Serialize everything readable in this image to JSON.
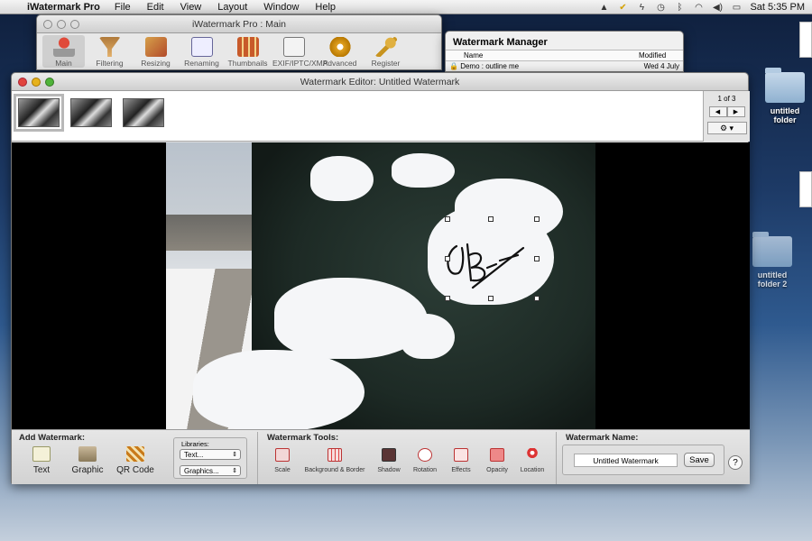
{
  "menubar": {
    "app": "iWatermark Pro",
    "items": [
      "File",
      "Edit",
      "View",
      "Layout",
      "Window",
      "Help"
    ],
    "clock": "Sat 5:35 PM"
  },
  "main_window": {
    "title": "iWatermark Pro : Main",
    "tools": [
      {
        "label": "Main",
        "icon": "stamp-icon"
      },
      {
        "label": "Filtering",
        "icon": "funnel-icon"
      },
      {
        "label": "Resizing",
        "icon": "resize-icon"
      },
      {
        "label": "Renaming",
        "icon": "rename-icon"
      },
      {
        "label": "Thumbnails",
        "icon": "thumbnails-icon"
      },
      {
        "label": "EXIF/IPTC/XMP",
        "icon": "exif-icon"
      },
      {
        "label": "Advanced",
        "icon": "gear-icon"
      },
      {
        "label": "Register",
        "icon": "key-icon"
      }
    ]
  },
  "watermark_manager": {
    "title": "Watermark Manager",
    "col_name": "Name",
    "col_modified": "Modified",
    "row_name": "Demo : outline me",
    "row_modified": "Wed 4 July"
  },
  "editor": {
    "title": "Watermark Editor: Untitled Watermark",
    "page_indicator": "1 of 3",
    "prev": "◀",
    "next": "▶",
    "gear": "⚙ ▾"
  },
  "bottom": {
    "add_title": "Add Watermark:",
    "add_text": "Text",
    "add_graphic": "Graphic",
    "add_qr": "QR Code",
    "libraries_label": "Libraries:",
    "lib_text": "Text...",
    "lib_graphics": "Graphics...",
    "tools_title": "Watermark Tools:",
    "tools": [
      "Scale",
      "Background & Border",
      "Shadow",
      "Rotation",
      "Effects",
      "Opacity",
      "Location"
    ],
    "name_title": "Watermark Name:",
    "name_value": "Untitled Watermark",
    "save": "Save",
    "help": "?"
  },
  "desktop": {
    "folder1": [
      "untitled",
      "folder"
    ],
    "folder2": [
      "untitled",
      "folder 2"
    ]
  },
  "colors": {
    "accent": "#c0392b",
    "desktop": "#1d3a66"
  }
}
